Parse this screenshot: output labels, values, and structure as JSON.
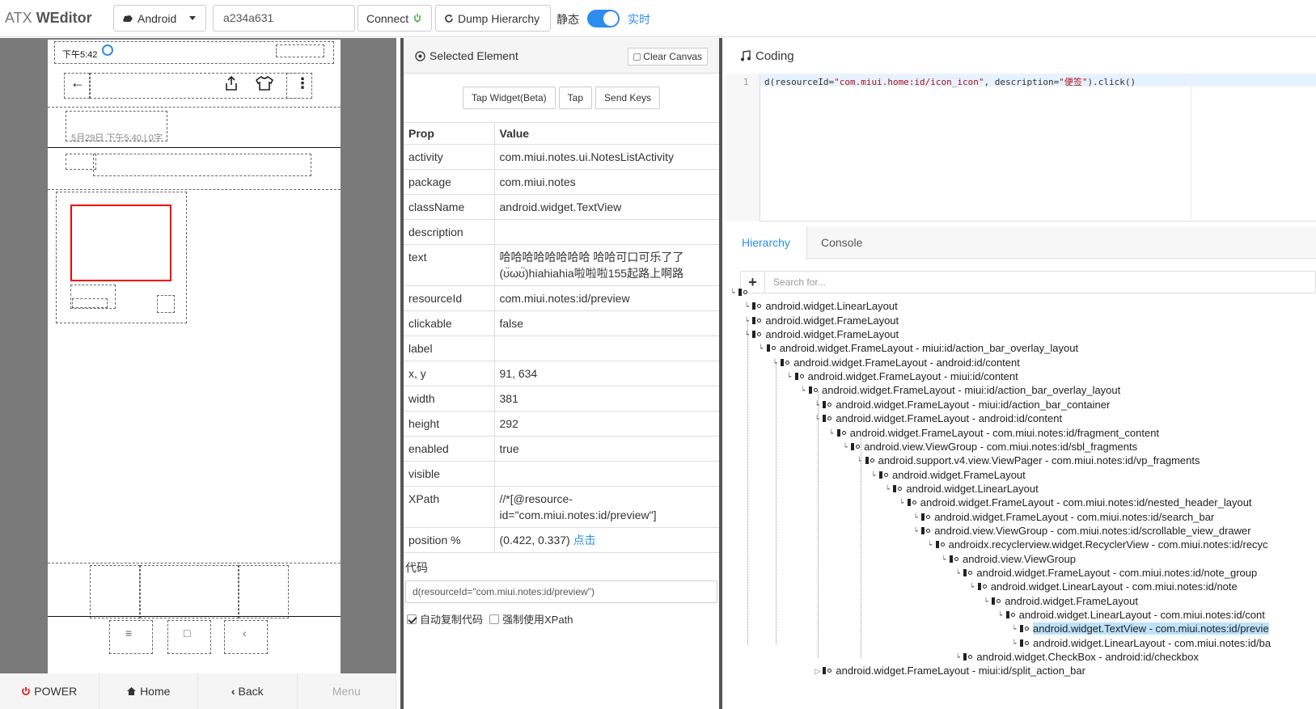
{
  "header": {
    "brand_light": "ATX",
    "brand_bold": "WEditor",
    "platform": "Android",
    "serial": "a234a631",
    "connect_label": "Connect",
    "dump_label": "Dump Hierarchy",
    "static_label": "静态",
    "live_label": "实时"
  },
  "device": {
    "status_time": "下午5:42",
    "date_text": "5月29日  下午5:40 | 0字"
  },
  "bottom_nav": {
    "power": "POWER",
    "home": "Home",
    "back": "Back",
    "menu": "Menu"
  },
  "selected": {
    "title": "Selected Element",
    "clear_canvas": "Clear Canvas",
    "tap_widget": "Tap Widget(Beta)",
    "tap": "Tap",
    "send_keys": "Send Keys",
    "col_prop": "Prop",
    "col_value": "Value",
    "props": [
      {
        "k": "activity",
        "v": "com.miui.notes.ui.NotesListActivity"
      },
      {
        "k": "package",
        "v": "com.miui.notes"
      },
      {
        "k": "className",
        "v": "android.widget.TextView"
      },
      {
        "k": "description",
        "v": ""
      },
      {
        "k": "text",
        "v": "哈哈哈哈哈哈哈哈 哈哈可口可乐了了 (ʊ̈ωʊ̈)hiahiahia啦啦啦155起路上啊路"
      },
      {
        "k": "resourceId",
        "v": "com.miui.notes:id/preview"
      },
      {
        "k": "clickable",
        "v": "false"
      },
      {
        "k": "label",
        "v": ""
      },
      {
        "k": "x, y",
        "v": "91, 634"
      },
      {
        "k": "width",
        "v": "381"
      },
      {
        "k": "height",
        "v": "292"
      },
      {
        "k": "enabled",
        "v": "true"
      },
      {
        "k": "visible",
        "v": ""
      },
      {
        "k": "XPath",
        "v": "//*[@resource-id=\"com.miui.notes:id/preview\"]"
      }
    ],
    "position_label": "position %",
    "position_value": "(0.422, 0.337)",
    "position_link": "点击",
    "code_label": "代码",
    "code_value": "d(resourceId=\"com.miui.notes:id/preview\")",
    "auto_copy": "自动复制代码",
    "force_xpath": "强制使用XPath"
  },
  "coding": {
    "title": "Coding",
    "line_no": "1",
    "code_prefix": "d(resourceId=",
    "code_str1": "\"com.miui.home:id/icon_icon\"",
    "code_mid": ", description=",
    "code_str2": "\"便签\"",
    "code_suffix": ").click()"
  },
  "tabs": {
    "hierarchy": "Hierarchy",
    "console": "Console",
    "search_placeholder": "Search for..."
  },
  "tree": [
    {
      "t": ""
    },
    {
      "t": "android.widget.LinearLayout"
    },
    {
      "t": "android.widget.FrameLayout"
    },
    {
      "t": "android.widget.FrameLayout"
    },
    {
      "t": "android.widget.FrameLayout - miui:id/action_bar_overlay_layout"
    },
    {
      "t": "android.widget.FrameLayout - android:id/content"
    },
    {
      "t": "android.widget.FrameLayout - miui:id/content"
    },
    {
      "t": "android.widget.FrameLayout - miui:id/action_bar_overlay_layout"
    },
    {
      "t": "android.widget.FrameLayout - miui:id/action_bar_container"
    },
    {
      "t": "android.widget.FrameLayout - android:id/content"
    },
    {
      "t": "android.widget.FrameLayout - com.miui.notes:id/fragment_content"
    },
    {
      "t": "android.view.ViewGroup - com.miui.notes:id/sbl_fragments"
    },
    {
      "t": "android.support.v4.view.ViewPager - com.miui.notes:id/vp_fragments"
    },
    {
      "t": "android.widget.FrameLayout"
    },
    {
      "t": "android.widget.LinearLayout"
    },
    {
      "t": "android.widget.FrameLayout - com.miui.notes:id/nested_header_layout"
    },
    {
      "t": "android.widget.FrameLayout - com.miui.notes:id/search_bar"
    },
    {
      "t": "android.view.ViewGroup - com.miui.notes:id/scrollable_view_drawer"
    },
    {
      "t": "androidx.recyclerview.widget.RecyclerView - com.miui.notes:id/recyc"
    },
    {
      "t": "android.view.ViewGroup"
    },
    {
      "t": "android.widget.FrameLayout - com.miui.notes:id/note_group"
    },
    {
      "t": "android.widget.LinearLayout - com.miui.notes:id/note"
    },
    {
      "t": "android.widget.FrameLayout"
    },
    {
      "t": "android.widget.LinearLayout - com.miui.notes:id/cont"
    },
    {
      "t": "android.widget.TextView - com.miui.notes:id/previe"
    },
    {
      "t": "android.widget.LinearLayout - com.miui.notes:id/ba"
    },
    {
      "t": "android.widget.CheckBox - android:id/checkbox"
    },
    {
      "t": "android.widget.FrameLayout - miui:id/split_action_bar"
    }
  ]
}
